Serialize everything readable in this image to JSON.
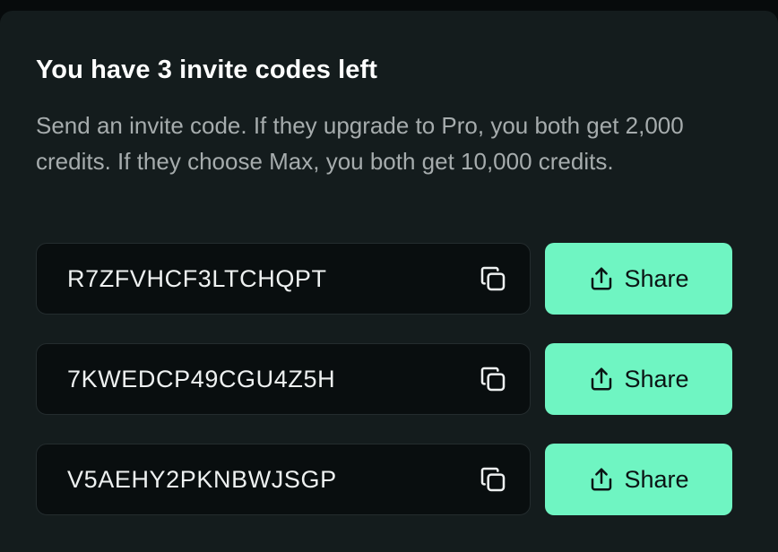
{
  "invite": {
    "title": "You have 3 invite codes left",
    "description": "Send an invite code. If they upgrade to Pro, you both get 2,000 credits. If they choose Max, you both get 10,000 credits.",
    "share_label": "Share",
    "copy_icon": "copy-icon",
    "share_icon": "share-upload-icon",
    "codes": [
      "R7ZFVHCF3LTCHQPT",
      "7KWEDCP49CGU4Z5H",
      "V5AEHY2PKNBWJSGP"
    ],
    "colors": {
      "panel_background": "#141c1d",
      "code_box_background": "#090e0f",
      "share_button": "#6ff5c2",
      "title_text": "#ffffff",
      "description_text": "#a6acad"
    }
  }
}
